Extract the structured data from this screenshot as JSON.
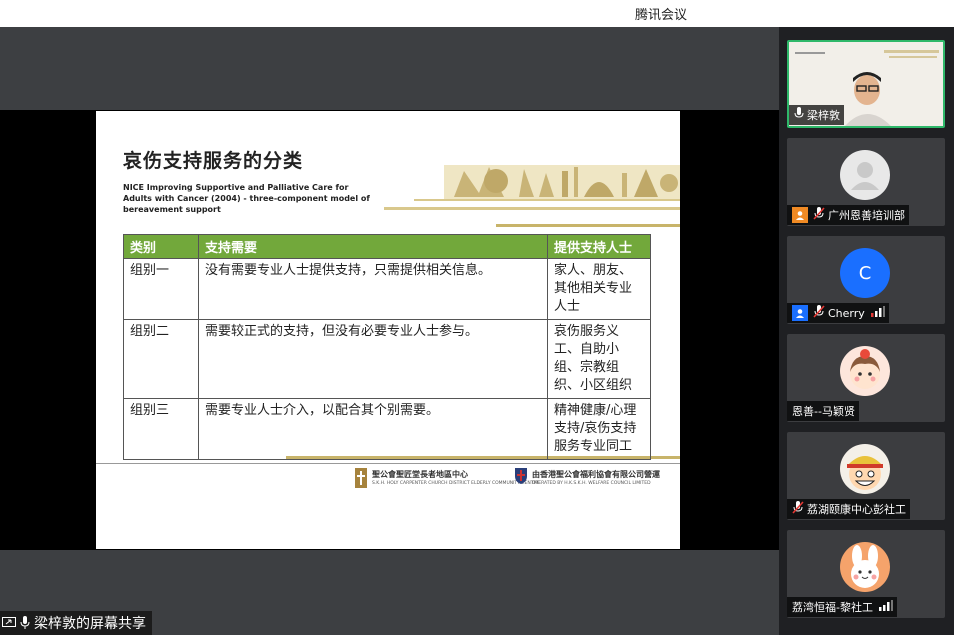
{
  "app": {
    "title": "腾讯会议"
  },
  "slide": {
    "title": "哀伤支持服务的分类",
    "subtitle": "NICE Improving Supportive and Palliative Care for Adults with Cancer (2004) - three-component model of bereavement support",
    "table": {
      "headers": [
        "类别",
        "支持需要",
        "提供支持人士"
      ],
      "rows": [
        [
          "组别一",
          "没有需要专业人士提供支持，只需提供相关信息。",
          "家人、朋友、其他相关专业人士"
        ],
        [
          "组别二",
          "需要较正式的支持，但没有必要专业人士参与。",
          "哀伤服务义工、自助小组、宗教组织、小区组织"
        ],
        [
          "组别三",
          "需要专业人士介入，以配合其个别需要。",
          "精神健康/心理支持/哀伤支持服务专业同工"
        ]
      ]
    },
    "logo_left": "聖公會聖匠堂長者地區中心",
    "logo_left_en": "S.K.H. HOLY CARPENTER CHURCH DISTRICT ELDERLY COMMUNITY CENTRE",
    "logo_right": "由香港聖公會福利協會有限公司營運",
    "logo_right_en": "OPERATED BY H.K.S.K.H. WELFARE COUNCIL LIMITED"
  },
  "share_status": {
    "label": "梁梓敦的屏幕共享"
  },
  "participants": [
    {
      "name": "梁梓敦",
      "type": "video",
      "speaking": true
    },
    {
      "name": "广州恩善培训部",
      "type": "avatar",
      "avatar": "default-user-avatar",
      "muted": true,
      "badge": "orange"
    },
    {
      "name": "Cherry",
      "type": "avatar",
      "avatar": "initial",
      "initial": "C",
      "avatar_color": "#1a6fff",
      "muted": true,
      "badge": "blue",
      "signal": true
    },
    {
      "name": "恩善--马颖贤",
      "type": "avatar",
      "avatar": "cartoon-girl-avatar"
    },
    {
      "name": "荔湖颐康中心彭社工",
      "type": "avatar",
      "avatar": "cartoon-boy-avatar",
      "muted": true
    },
    {
      "name": "荔湾恒福-黎社工",
      "type": "avatar",
      "avatar": "cartoon-rabbit-avatar",
      "signal": true
    }
  ],
  "colors": {
    "table_header": "#72a83b",
    "active_border": "#2fb86a",
    "gold": "#c8b46a"
  }
}
